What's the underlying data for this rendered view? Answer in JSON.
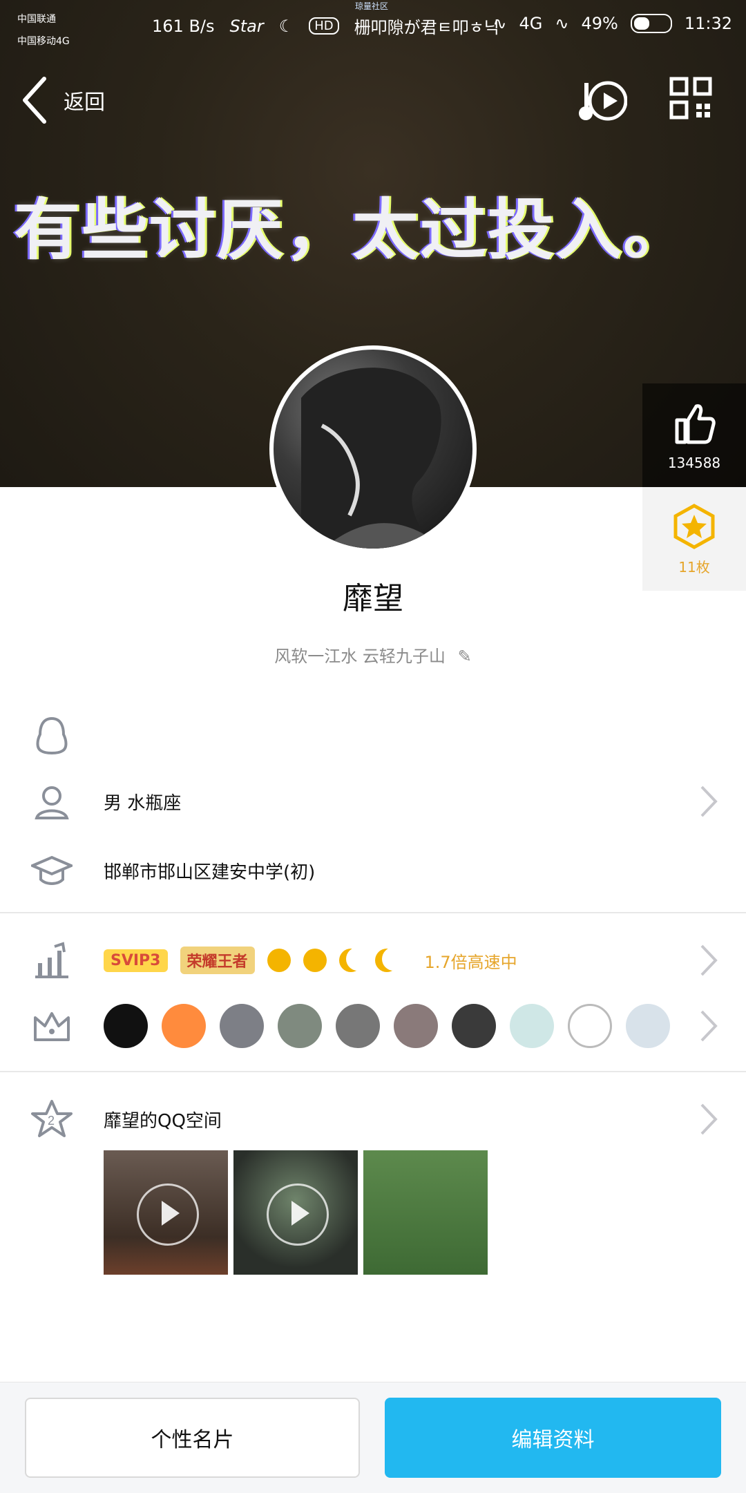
{
  "status_bar": {
    "carrier1": "中国联通",
    "carrier2": "中国移动4G",
    "speed": "161 B/s",
    "star": "Star",
    "hd": "HD",
    "center_text": "栅叩隙が君ㅌ叩ㅎ닉",
    "micro_text": "琼量社区",
    "network": "4G",
    "battery": "49%",
    "time": "11:32"
  },
  "header": {
    "back_label": "返回",
    "cover_text": "有些讨厌，太过投入。"
  },
  "stats": {
    "likes": "134588",
    "coins": "11枚"
  },
  "profile": {
    "nickname": "靡望",
    "signature": "风软一江水  云轻九子山",
    "gender_zodiac": "男  水瓶座",
    "school": "邯郸市邯山区建安中学(初)"
  },
  "badges_row": {
    "svip": "SVIP3",
    "honor": "荣耀王者",
    "speed_text": "1.7倍高速中"
  },
  "space": {
    "title": "靡望的QQ空间"
  },
  "buttons": {
    "card": "个性名片",
    "edit": "编辑资料"
  },
  "colors": {
    "accent_blue": "#22b8f0",
    "gold": "#e6a52a"
  }
}
